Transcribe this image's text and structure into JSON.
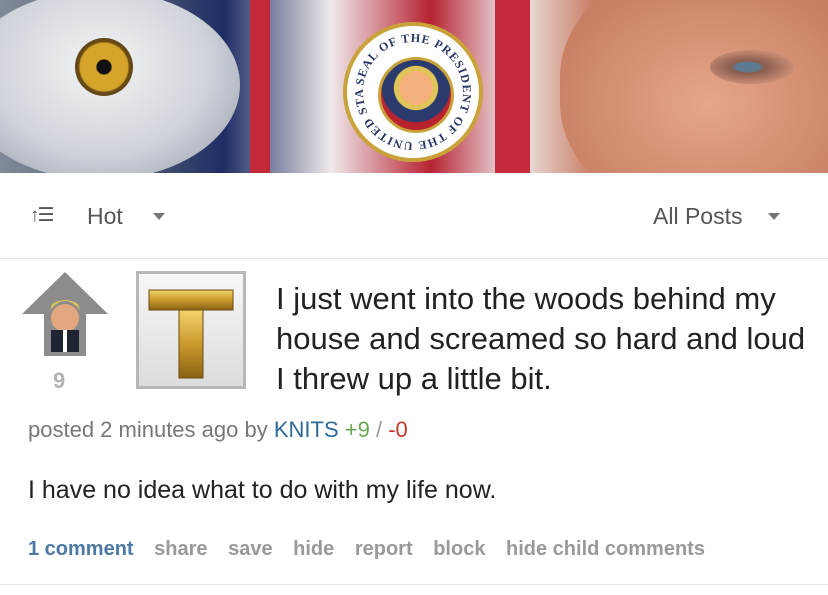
{
  "banner": {
    "seal_text": "SEAL OF THE PRESIDENT OF THE UNITED STATES"
  },
  "sort": {
    "icon": "sort-icon",
    "label": "Hot"
  },
  "filter": {
    "label": "All Posts"
  },
  "post": {
    "score": "9",
    "thumbnail_letter": "T",
    "title": "I just went into the woods behind my house and screamed so hard and loud I threw up a little bit.",
    "meta": {
      "posted": "posted 2 minutes ago by",
      "author": "KNITS",
      "upvotes": "+9",
      "separator": "/",
      "downvotes": "-0"
    },
    "body": "I have no idea what to do with my life now.",
    "actions": {
      "comments": "1 comment",
      "share": "share",
      "save": "save",
      "hide": "hide",
      "report": "report",
      "block": "block",
      "hide_child": "hide child comments"
    }
  },
  "colors": {
    "author": "#2d6a9a",
    "upvote": "#6aa84f",
    "downvote": "#c0392b",
    "comment_link": "#4b79a4",
    "action_gray": "#999999",
    "seal_gold": "#c9a33a"
  }
}
